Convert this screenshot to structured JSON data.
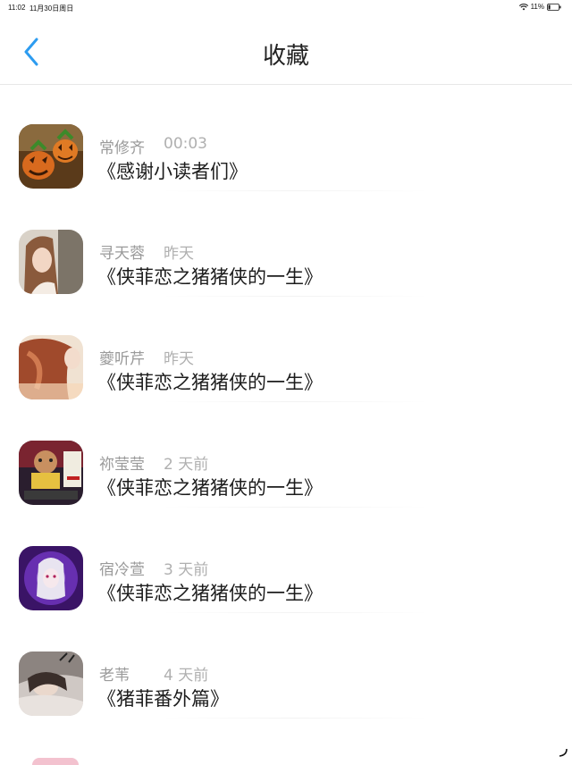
{
  "status_bar": {
    "time": "11:02",
    "date": "11月30日周日",
    "battery": "11%"
  },
  "header": {
    "title": "收藏"
  },
  "items": [
    {
      "name": "常修齐",
      "time": "00:03",
      "title": "《感谢小读者们》",
      "avatar": "pumpkin-avatar"
    },
    {
      "name": "寻天蓉",
      "time": "昨天",
      "title": "《侠菲恋之猪猪侠的一生》",
      "avatar": "girl-photo-avatar"
    },
    {
      "name": "夔听芹",
      "time": "昨天",
      "title": "《侠菲恋之猪猪侠的一生》",
      "avatar": "red-hair-avatar"
    },
    {
      "name": "祢莹莹",
      "time": "2 天前",
      "title": "《侠菲恋之猪猪侠的一生》",
      "avatar": "cartoon-avatar"
    },
    {
      "name": "宿冷萱",
      "time": "3 天前",
      "title": "《侠菲恋之猪猪侠的一生》",
      "avatar": "anime-purple-avatar"
    },
    {
      "name": "老苇",
      "time": "4 天前",
      "title": "《猪菲番外篇》",
      "avatar": "sleeping-girl-avatar"
    }
  ]
}
